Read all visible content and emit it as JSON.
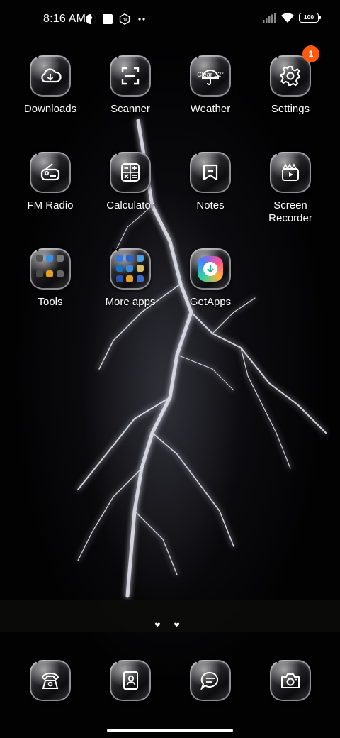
{
  "status_bar": {
    "time": "8:16 AM",
    "left_icons": [
      "contrast-icon",
      "square-notification-icon",
      "mi-icon",
      "more-dots-icon"
    ],
    "right_icons": [
      "signal-icon",
      "wifi-icon"
    ],
    "battery_level": "100"
  },
  "apps": [
    {
      "label": "Downloads",
      "icon": "cloud-download-icon"
    },
    {
      "label": "Scanner",
      "icon": "scanner-icon"
    },
    {
      "label": "Weather",
      "icon": "weather-icon",
      "icon_text": "Clear 22°"
    },
    {
      "label": "Settings",
      "icon": "gear-icon",
      "badge": "1"
    },
    {
      "label": "FM Radio",
      "icon": "radio-icon"
    },
    {
      "label": "Calculator",
      "icon": "calculator-icon"
    },
    {
      "label": "Notes",
      "icon": "notes-icon"
    },
    {
      "label": "Screen Recorder",
      "label_line1": "Screen",
      "label_line2": "Recorder",
      "icon": "video-camera-icon"
    },
    {
      "label": "Tools",
      "icon": "folder-icon"
    },
    {
      "label": "More apps",
      "icon": "folder-icon"
    },
    {
      "label": "GetApps",
      "icon": "getapps-icon"
    }
  ],
  "page_indicator": "❤ ❤",
  "dock": [
    {
      "icon": "phone-icon"
    },
    {
      "icon": "contacts-icon"
    },
    {
      "icon": "messages-icon"
    },
    {
      "icon": "camera-icon"
    }
  ],
  "colors": {
    "badge": "#ff5a10",
    "background": "#000000"
  }
}
